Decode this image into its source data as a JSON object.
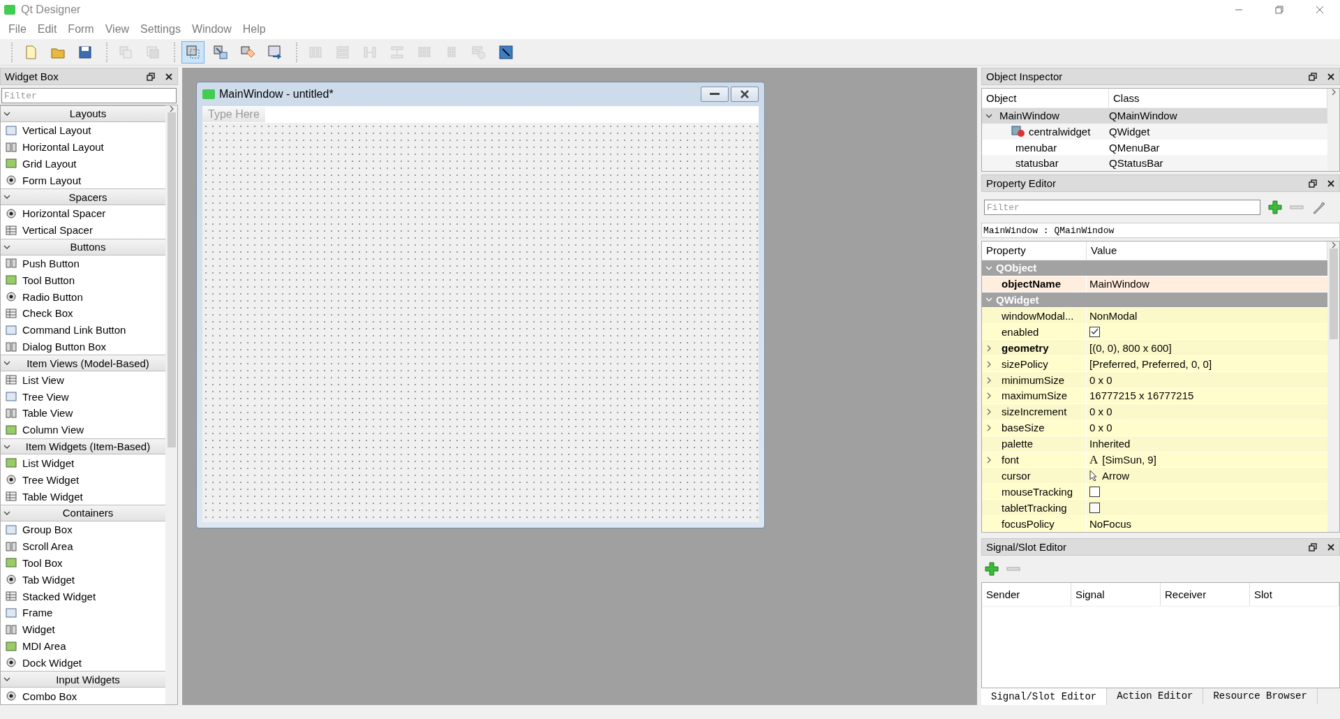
{
  "window": {
    "title": "Qt Designer"
  },
  "menu": [
    "File",
    "Edit",
    "Form",
    "View",
    "Settings",
    "Window",
    "Help"
  ],
  "toolbar": [
    {
      "kind": "new",
      "selected": false,
      "disabled": false
    },
    {
      "kind": "open",
      "selected": false,
      "disabled": false
    },
    {
      "kind": "save",
      "selected": false,
      "disabled": false
    },
    {
      "kind": "sep"
    },
    {
      "kind": "copy",
      "selected": false,
      "disabled": true
    },
    {
      "kind": "paste",
      "selected": false,
      "disabled": true
    },
    {
      "kind": "sep"
    },
    {
      "kind": "widgets",
      "selected": true,
      "disabled": false
    },
    {
      "kind": "signals",
      "selected": false,
      "disabled": false
    },
    {
      "kind": "buddies",
      "selected": false,
      "disabled": false
    },
    {
      "kind": "taborder",
      "selected": false,
      "disabled": false
    },
    {
      "kind": "sep"
    },
    {
      "kind": "hlayout",
      "selected": false,
      "disabled": true
    },
    {
      "kind": "vlayout",
      "selected": false,
      "disabled": true
    },
    {
      "kind": "hsplit",
      "selected": false,
      "disabled": true
    },
    {
      "kind": "vsplit",
      "selected": false,
      "disabled": true
    },
    {
      "kind": "grid",
      "selected": false,
      "disabled": true
    },
    {
      "kind": "form",
      "selected": false,
      "disabled": true
    },
    {
      "kind": "break",
      "selected": false,
      "disabled": true
    },
    {
      "kind": "adjust",
      "selected": false,
      "disabled": false
    }
  ],
  "widget_box": {
    "title": "Widget Box",
    "filter": {
      "placeholder": "Filter"
    },
    "categories": [
      {
        "title": "Layouts",
        "expanded": true,
        "items": [
          "Vertical Layout",
          "Horizontal Layout",
          "Grid Layout",
          "Form Layout"
        ]
      },
      {
        "title": "Spacers",
        "expanded": true,
        "items": [
          "Horizontal Spacer",
          "Vertical Spacer"
        ]
      },
      {
        "title": "Buttons",
        "expanded": true,
        "items": [
          "Push Button",
          "Tool Button",
          "Radio Button",
          "Check Box",
          "Command Link Button",
          "Dialog Button Box"
        ]
      },
      {
        "title": "Item Views (Model-Based)",
        "expanded": true,
        "items": [
          "List View",
          "Tree View",
          "Table View",
          "Column View"
        ]
      },
      {
        "title": "Item Widgets (Item-Based)",
        "expanded": true,
        "items": [
          "List Widget",
          "Tree Widget",
          "Table Widget"
        ]
      },
      {
        "title": "Containers",
        "expanded": true,
        "items": [
          "Group Box",
          "Scroll Area",
          "Tool Box",
          "Tab Widget",
          "Stacked Widget",
          "Frame",
          "Widget",
          "MDI Area",
          "Dock Widget"
        ]
      },
      {
        "title": "Input Widgets",
        "expanded": true,
        "items": [
          "Combo Box"
        ]
      }
    ]
  },
  "form": {
    "title": "MainWindow - untitled*",
    "menu_placeholder": "Type Here"
  },
  "object_inspector": {
    "title": "Object Inspector",
    "columns": [
      "Object",
      "Class"
    ],
    "tree": [
      {
        "object": "MainWindow",
        "class": "QMainWindow",
        "expanded": true,
        "selected": true,
        "children": [
          {
            "object": "centralwidget",
            "class": "QWidget",
            "selected": false
          },
          {
            "object": "menubar",
            "class": "QMenuBar",
            "selected": false
          },
          {
            "object": "statusbar",
            "class": "QStatusBar",
            "selected": false
          }
        ]
      }
    ]
  },
  "property_editor": {
    "title": "Property Editor",
    "filter": {
      "placeholder": "Filter"
    },
    "object_line": "MainWindow : QMainWindow",
    "columns": [
      "Property",
      "Value"
    ],
    "groups": [
      {
        "name": "QObject",
        "expanded": true,
        "color": "#ffeedd",
        "rows": [
          {
            "name": "objectName",
            "bold": true,
            "kind": "text",
            "value": "MainWindow"
          }
        ]
      },
      {
        "name": "QWidget",
        "expanded": true,
        "color": "#fffdcc",
        "rows": [
          {
            "name": "windowModal...",
            "kind": "text",
            "value": "NonModal"
          },
          {
            "name": "enabled",
            "kind": "check",
            "checked": true
          },
          {
            "name": "geometry",
            "bold": true,
            "expanded": false,
            "kind": "text",
            "value": "[(0, 0), 800 x 600]"
          },
          {
            "name": "sizePolicy",
            "expanded": false,
            "kind": "text",
            "value": "[Preferred, Preferred, 0, 0]"
          },
          {
            "name": "minimumSize",
            "expanded": false,
            "kind": "text",
            "value": "0 x 0"
          },
          {
            "name": "maximumSize",
            "expanded": false,
            "kind": "text",
            "value": "16777215 x 16777215"
          },
          {
            "name": "sizeIncrement",
            "expanded": false,
            "kind": "text",
            "value": "0 x 0"
          },
          {
            "name": "baseSize",
            "expanded": false,
            "kind": "text",
            "value": "0 x 0"
          },
          {
            "name": "palette",
            "kind": "text",
            "value": "Inherited"
          },
          {
            "name": "font",
            "expanded": false,
            "kind": "font",
            "glyph": "A",
            "value": "[SimSun, 9]"
          },
          {
            "name": "cursor",
            "kind": "cursor",
            "value": "Arrow"
          },
          {
            "name": "mouseTracking",
            "kind": "check",
            "checked": false
          },
          {
            "name": "tabletTracking",
            "kind": "check",
            "checked": false
          },
          {
            "name": "focusPolicy",
            "kind": "text",
            "value": "NoFocus"
          }
        ]
      }
    ]
  },
  "signal_slot_editor": {
    "title": "Signal/Slot Editor",
    "columns": [
      "Sender",
      "Signal",
      "Receiver",
      "Slot"
    ]
  },
  "bottom_tabs": [
    {
      "label": "Signal/Slot Editor",
      "selected": true
    },
    {
      "label": "Action Editor",
      "selected": false
    },
    {
      "label": "Resource Browser",
      "selected": false
    }
  ]
}
